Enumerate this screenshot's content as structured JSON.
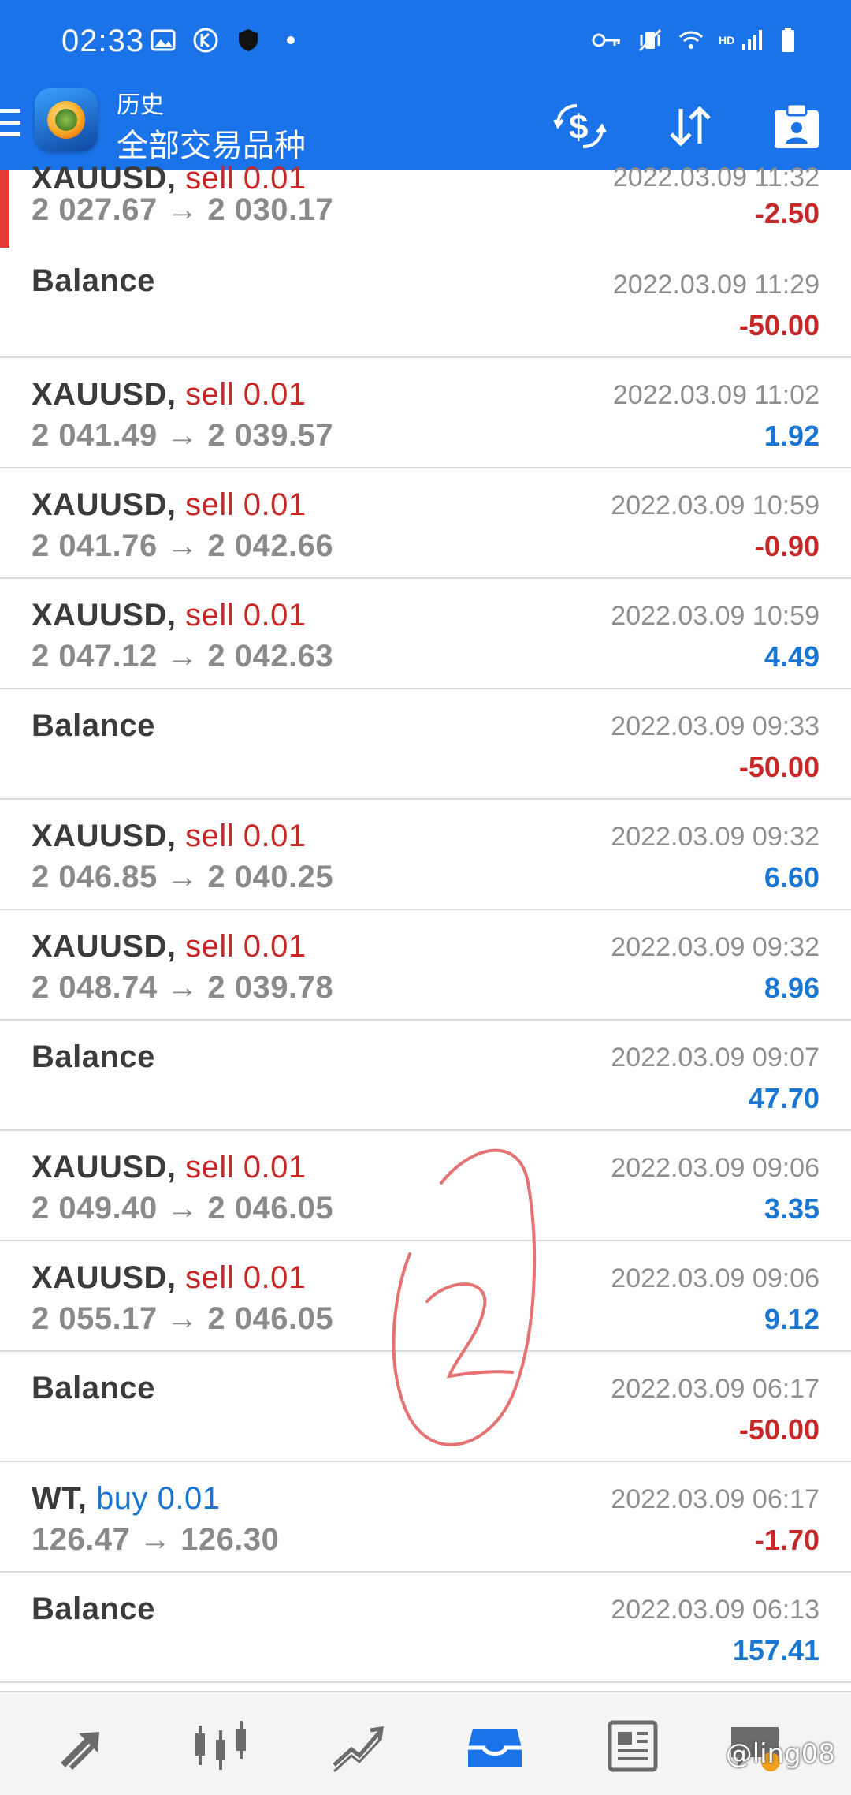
{
  "status": {
    "time": "02:33"
  },
  "header": {
    "title_small": "历史",
    "title_large": "全部交易品种"
  },
  "rows": [
    {
      "symbol": "XAUUSD",
      "side": "sell 0.01",
      "side_type": "sell",
      "prices": "2 027.67 → 2 030.17",
      "date": "2022.03.09 11:32",
      "amount": "-2.50",
      "amount_type": "neg"
    },
    {
      "symbol": "Balance",
      "date": "2022.03.09 11:29",
      "amount": "-50.00",
      "amount_type": "neg"
    },
    {
      "symbol": "XAUUSD",
      "side": "sell 0.01",
      "side_type": "sell",
      "prices": "2 041.49 → 2 039.57",
      "date": "2022.03.09 11:02",
      "amount": "1.92",
      "amount_type": "pos"
    },
    {
      "symbol": "XAUUSD",
      "side": "sell 0.01",
      "side_type": "sell",
      "prices": "2 041.76 → 2 042.66",
      "date": "2022.03.09 10:59",
      "amount": "-0.90",
      "amount_type": "neg"
    },
    {
      "symbol": "XAUUSD",
      "side": "sell 0.01",
      "side_type": "sell",
      "prices": "2 047.12 → 2 042.63",
      "date": "2022.03.09 10:59",
      "amount": "4.49",
      "amount_type": "pos"
    },
    {
      "symbol": "Balance",
      "date": "2022.03.09 09:33",
      "amount": "-50.00",
      "amount_type": "neg"
    },
    {
      "symbol": "XAUUSD",
      "side": "sell 0.01",
      "side_type": "sell",
      "prices": "2 046.85 → 2 040.25",
      "date": "2022.03.09 09:32",
      "amount": "6.60",
      "amount_type": "pos"
    },
    {
      "symbol": "XAUUSD",
      "side": "sell 0.01",
      "side_type": "sell",
      "prices": "2 048.74 → 2 039.78",
      "date": "2022.03.09 09:32",
      "amount": "8.96",
      "amount_type": "pos"
    },
    {
      "symbol": "Balance",
      "date": "2022.03.09 09:07",
      "amount": "47.70",
      "amount_type": "pos"
    },
    {
      "symbol": "XAUUSD",
      "side": "sell 0.01",
      "side_type": "sell",
      "prices": "2 049.40 → 2 046.05",
      "date": "2022.03.09 09:06",
      "amount": "3.35",
      "amount_type": "pos"
    },
    {
      "symbol": "XAUUSD",
      "side": "sell 0.01",
      "side_type": "sell",
      "prices": "2 055.17 → 2 046.05",
      "date": "2022.03.09 09:06",
      "amount": "9.12",
      "amount_type": "pos"
    },
    {
      "symbol": "Balance",
      "date": "2022.03.09 06:17",
      "amount": "-50.00",
      "amount_type": "neg"
    },
    {
      "symbol": "WT",
      "side": "buy 0.01",
      "side_type": "buy",
      "prices": "126.47 → 126.30",
      "date": "2022.03.09 06:17",
      "amount": "-1.70",
      "amount_type": "neg"
    },
    {
      "symbol": "Balance",
      "date": "2022.03.09 06:13",
      "amount": "157.41",
      "amount_type": "pos"
    }
  ],
  "watermark": "@ling08",
  "colors": {
    "brand": "#1a73e8",
    "negative": "#c62828",
    "positive": "#1976d2",
    "highlight": "#e53935"
  },
  "icons": {
    "statusbar": [
      "gallery-icon",
      "k-app-icon",
      "shield-icon",
      "dot-icon",
      "key-icon",
      "vibrate-icon",
      "wifi-icon",
      "signal-icon",
      "battery-icon"
    ],
    "appbar": [
      "menu-icon",
      "app-logo",
      "currency-exchange-icon",
      "sort-icon",
      "add-report-icon"
    ],
    "bottom_nav": [
      "quotes-icon",
      "chart-candles-icon",
      "trade-icon",
      "history-inbox-icon",
      "news-icon",
      "chat-icon"
    ]
  }
}
